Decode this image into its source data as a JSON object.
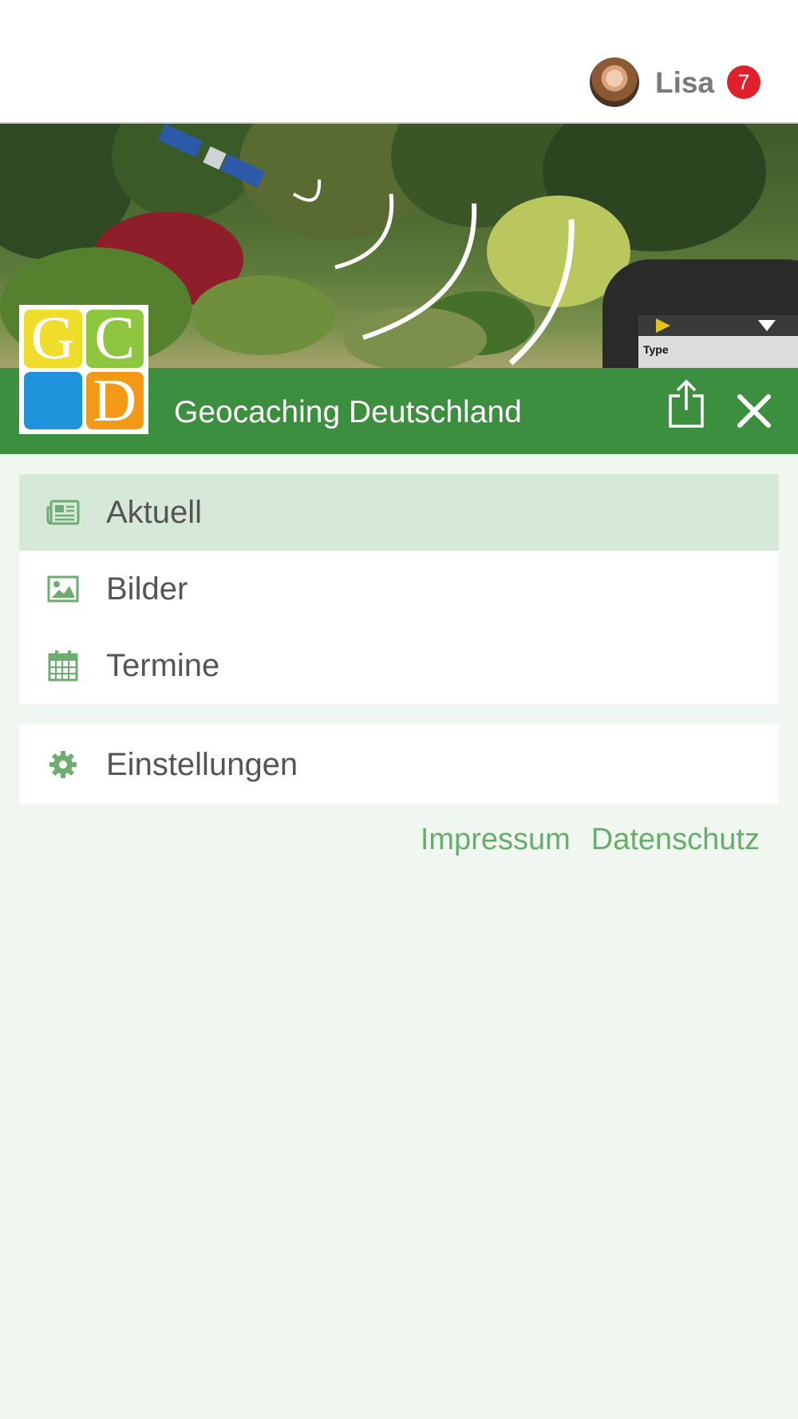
{
  "user": {
    "name": "Lisa",
    "notification_count": "7"
  },
  "header": {
    "app_title": "Geocaching Deutschland",
    "logo_letters": [
      "G",
      "C",
      "",
      "D"
    ]
  },
  "banner": {
    "device_label": "Type"
  },
  "menu": {
    "items": [
      {
        "label": "Aktuell",
        "icon": "newspaper-icon",
        "active": true
      },
      {
        "label": "Bilder",
        "icon": "image-icon",
        "active": false
      },
      {
        "label": "Termine",
        "icon": "calendar-icon",
        "active": false
      }
    ],
    "settings": {
      "label": "Einstellungen",
      "icon": "gear-icon"
    }
  },
  "footer": {
    "impressum": "Impressum",
    "datenschutz": "Datenschutz"
  },
  "colors": {
    "brand_green": "#3b8f3e",
    "active_item_bg": "#d6e9d8",
    "link_green": "#69ad6c",
    "badge_red": "#e0202a"
  }
}
